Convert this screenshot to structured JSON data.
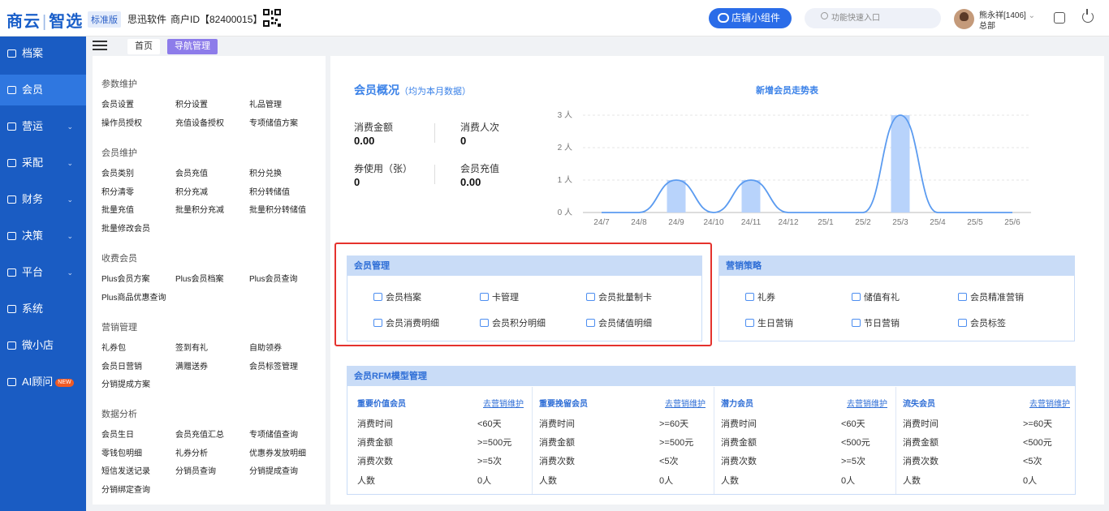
{
  "header": {
    "logo_a": "商云",
    "logo_sep": "|",
    "logo_b": "智选",
    "edition": "标准版",
    "company": "思迅软件",
    "merchant_id": "商户ID【82400015】",
    "widget_button": "店铺小组件",
    "search_placeholder": "功能快速入口",
    "user_name": "熊永祥[1406]",
    "user_org": "总部"
  },
  "sidebar": {
    "items": [
      {
        "label": "档案",
        "icon": "archive-icon",
        "active": false,
        "has_arrow": false
      },
      {
        "label": "会员",
        "icon": "user-icon",
        "active": true,
        "has_arrow": false
      },
      {
        "label": "营运",
        "icon": "store-icon",
        "active": false,
        "has_arrow": true
      },
      {
        "label": "采配",
        "icon": "purchase-icon",
        "active": false,
        "has_arrow": true
      },
      {
        "label": "财务",
        "icon": "finance-icon",
        "active": false,
        "has_arrow": true
      },
      {
        "label": "决策",
        "icon": "decision-icon",
        "active": false,
        "has_arrow": true
      },
      {
        "label": "平台",
        "icon": "monitor-icon",
        "active": false,
        "has_arrow": true
      },
      {
        "label": "系统",
        "icon": "settings-icon",
        "active": false,
        "has_arrow": false
      },
      {
        "label": "微小店",
        "icon": "shop-icon",
        "active": false,
        "has_arrow": false
      },
      {
        "label": "AI顾问",
        "icon": "ai-icon",
        "active": false,
        "has_arrow": false,
        "badge": "NEW"
      }
    ]
  },
  "tabs": {
    "home": "首页",
    "nav": "导航管理"
  },
  "nav_groups": [
    {
      "title": "参数维护",
      "items": [
        "会员设置",
        "积分设置",
        "礼品管理",
        "操作员授权",
        "充值设备授权",
        "专项储值方案"
      ]
    },
    {
      "title": "会员维护",
      "items": [
        "会员类别",
        "会员充值",
        "积分兑换",
        "积分清零",
        "积分充减",
        "积分转储值",
        "批量充值",
        "批量积分充减",
        "批量积分转储值",
        "批量修改会员"
      ]
    },
    {
      "title": "收费会员",
      "items": [
        "Plus会员方案",
        "Plus会员档案",
        "Plus会员查询",
        "Plus商品优惠查询"
      ]
    },
    {
      "title": "营销管理",
      "items": [
        "礼券包",
        "签到有礼",
        "自助领券",
        "会员日营销",
        "满赠送券",
        "会员标签管理",
        "分销提成方案"
      ]
    },
    {
      "title": "数据分析",
      "items": [
        "会员生日",
        "会员充值汇总",
        "专项储值查询",
        "零钱包明细",
        "礼券分析",
        "优惠券发放明细",
        "短信发送记录",
        "分销员查询",
        "分销提成查询",
        "分销绑定查询"
      ]
    }
  ],
  "overview": {
    "title": "会员概况",
    "subtitle": "（均为本月数据）",
    "stats": [
      {
        "label": "消费金额",
        "value": "0.00"
      },
      {
        "label": "消费人次",
        "value": "0"
      },
      {
        "label": "券使用（张）",
        "value": "0"
      },
      {
        "label": "会员充值",
        "value": "0.00"
      }
    ]
  },
  "chart_data": {
    "type": "bar",
    "title": "新增会员走势表",
    "categories": [
      "24/7",
      "24/8",
      "24/9",
      "24/10",
      "24/11",
      "24/12",
      "25/1",
      "25/2",
      "25/3",
      "25/4",
      "25/5",
      "25/6"
    ],
    "values": [
      0,
      0,
      1,
      0,
      1,
      0,
      0,
      0,
      3,
      0,
      0,
      0
    ],
    "ylim": [
      0,
      3
    ],
    "y_ticks": [
      "0 人",
      "1 人",
      "2 人",
      "3 人"
    ],
    "overlay": "smooth-line",
    "bar_color": "#b8d3fb",
    "line_color": "#5b9bf0"
  },
  "member_mgmt": {
    "title": "会员管理",
    "items": [
      {
        "label": "会员档案",
        "icon": "crown-icon"
      },
      {
        "label": "卡管理",
        "icon": "card-icon"
      },
      {
        "label": "会员批量制卡",
        "icon": "batch-card-icon"
      },
      {
        "label": "会员消费明细",
        "icon": "receipt-icon"
      },
      {
        "label": "会员积分明细",
        "icon": "coins-icon"
      },
      {
        "label": "会员储值明细",
        "icon": "wallet-icon"
      }
    ]
  },
  "marketing": {
    "title": "营销策略",
    "items": [
      {
        "label": "礼券",
        "icon": "coupon-icon"
      },
      {
        "label": "储值有礼",
        "icon": "gift-icon"
      },
      {
        "label": "会员精准营销",
        "icon": "target-icon"
      },
      {
        "label": "生日营销",
        "icon": "birthday-icon"
      },
      {
        "label": "节日营销",
        "icon": "festival-icon"
      },
      {
        "label": "会员标签",
        "icon": "tag-icon"
      }
    ]
  },
  "rfm": {
    "title": "会员RFM模型管理",
    "link": "去营销维护",
    "row_labels": [
      "消费时间",
      "消费金额",
      "消费次数",
      "人数"
    ],
    "columns": [
      {
        "name": "重要价值会员",
        "values": [
          "<60天",
          ">=500元",
          ">=5次",
          "0人"
        ]
      },
      {
        "name": "重要挽留会员",
        "values": [
          ">=60天",
          ">=500元",
          "<5次",
          "0人"
        ]
      },
      {
        "name": "潜力会员",
        "values": [
          "<60天",
          "<500元",
          ">=5次",
          "0人"
        ]
      },
      {
        "name": "流失会员",
        "values": [
          ">=60天",
          "<500元",
          "<5次",
          "0人"
        ]
      }
    ]
  }
}
